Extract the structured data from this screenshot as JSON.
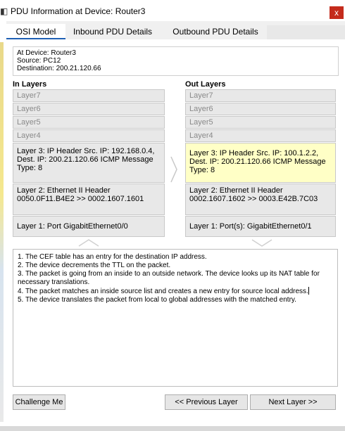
{
  "window": {
    "title": "PDU Information at Device: Router3",
    "close_label": "x"
  },
  "tabs": [
    {
      "label": "OSI Model",
      "active": true
    },
    {
      "label": "Inbound PDU Details",
      "active": false
    },
    {
      "label": "Outbound PDU Details",
      "active": false
    }
  ],
  "info": {
    "device": "At Device: Router3",
    "source": "Source: PC12",
    "destination": "Destination: 200.21.120.66"
  },
  "in_layers": {
    "heading": "In Layers",
    "items": [
      "Layer7",
      "Layer6",
      "Layer5",
      "Layer4",
      "Layer 3: IP Header Src. IP: 192.168.0.4, Dest. IP: 200.21.120.66 ICMP Message Type: 8",
      "Layer 2: Ethernet II Header 0050.0F11.B4E2 >> 0002.1607.1601",
      "Layer 1: Port GigabitEthernet0/0"
    ]
  },
  "out_layers": {
    "heading": "Out Layers",
    "items": [
      "Layer7",
      "Layer6",
      "Layer5",
      "Layer4",
      "Layer 3: IP Header Src. IP: 100.1.2.2, Dest. IP: 200.21.120.66 ICMP Message Type: 8",
      "Layer 2: Ethernet II Header 0002.1607.1602 >> 0003.E42B.7C03",
      "Layer 1: Port(s): GigabitEthernet0/1"
    ]
  },
  "log": [
    "1. The CEF table has an entry for the destination IP address.",
    "2. The device decrements the TTL on the packet.",
    "3. The packet is going from an inside to an outside network. The device looks up its NAT table for necessary translations.",
    "4. The packet matches an inside source list and creates a new entry for source local address.",
    "5. The device translates the packet from local to global addresses with the matched entry."
  ],
  "buttons": {
    "challenge": "Challenge Me",
    "previous": "<< Previous Layer",
    "next": "Next Layer >>"
  },
  "colors": {
    "highlight": "#ffffc6",
    "layer_bg": "#e8e8e8",
    "close_bg": "#c42b1c",
    "tab_accent": "#1e5fb4"
  }
}
